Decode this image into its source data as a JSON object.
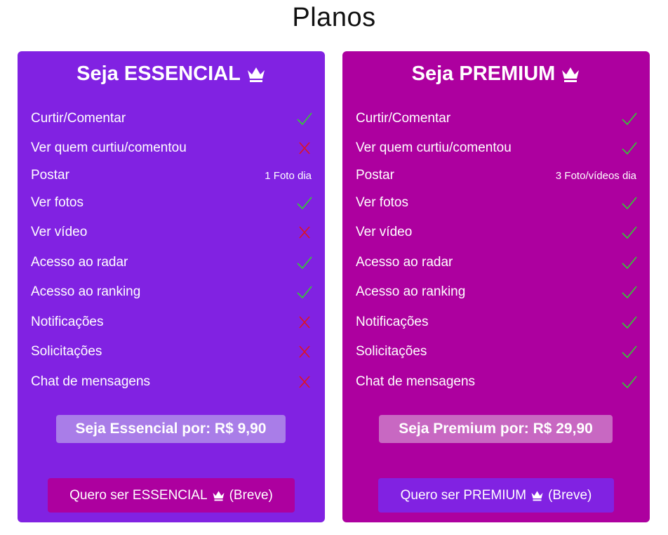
{
  "page": {
    "title": "Planos"
  },
  "colors": {
    "essencial_bg": "#8122e2",
    "premium_bg": "#ad009f",
    "check_color": "#32cd32",
    "cross_color": "#e0141e",
    "essencial_badge": "#a97de8",
    "premium_badge": "#c868c2"
  },
  "plans": [
    {
      "title": "Seja ESSENCIAL",
      "title_icon": "crown-icon",
      "features": [
        {
          "label": "Curtir/Comentar",
          "status": "check"
        },
        {
          "label": "Ver quem curtiu/comentou",
          "status": "cross"
        },
        {
          "label": "Postar",
          "status": "text",
          "value": "1 Foto dia"
        },
        {
          "label": "Ver fotos",
          "status": "check"
        },
        {
          "label": "Ver vídeo",
          "status": "cross"
        },
        {
          "label": "Acesso ao radar",
          "status": "check"
        },
        {
          "label": "Acesso ao ranking",
          "status": "check"
        },
        {
          "label": "Notificações",
          "status": "cross"
        },
        {
          "label": "Solicitações",
          "status": "cross"
        },
        {
          "label": "Chat de mensagens",
          "status": "cross"
        }
      ],
      "price_label": "Seja Essencial por: R$ 9,90",
      "button": {
        "before": "Quero ser ESSENCIAL",
        "after": "(Breve)"
      }
    },
    {
      "title": "Seja PREMIUM",
      "title_icon": "crown-icon",
      "features": [
        {
          "label": "Curtir/Comentar",
          "status": "check"
        },
        {
          "label": "Ver quem curtiu/comentou",
          "status": "check"
        },
        {
          "label": "Postar",
          "status": "text",
          "value": "3 Foto/vídeos dia"
        },
        {
          "label": "Ver fotos",
          "status": "check"
        },
        {
          "label": "Ver vídeo",
          "status": "check"
        },
        {
          "label": "Acesso ao radar",
          "status": "check"
        },
        {
          "label": "Acesso ao ranking",
          "status": "check"
        },
        {
          "label": "Notificações",
          "status": "check"
        },
        {
          "label": "Solicitações",
          "status": "check"
        },
        {
          "label": "Chat de mensagens",
          "status": "check"
        }
      ],
      "price_label": "Seja Premium por: R$ 29,90",
      "button": {
        "before": "Quero ser PREMIUM",
        "after": "(Breve)"
      }
    }
  ]
}
